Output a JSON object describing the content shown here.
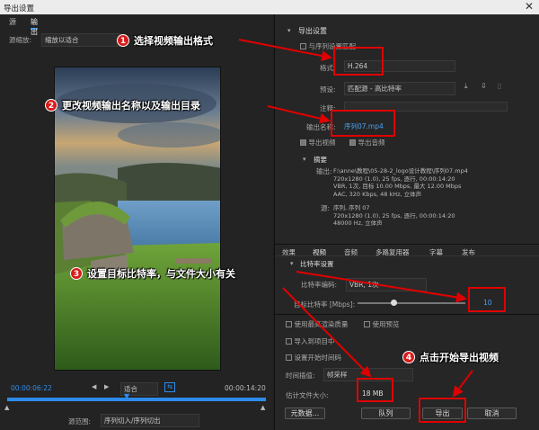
{
  "window": {
    "title": "导出设置",
    "close": "✕"
  },
  "left": {
    "tabs": [
      "源",
      "输出"
    ],
    "scale_label": "源缩放:",
    "scale_value": "缩放以适合",
    "time_current": "00:00:06:22",
    "time_end": "00:00:14:20",
    "fit_value": "适合",
    "source_range_label": "源范围:",
    "source_range_value": "序列切入/序列切出"
  },
  "right": {
    "section_title": "导出设置",
    "match_seq": "与序列设置匹配",
    "format_label": "格式:",
    "format_value": "H.264",
    "preset_label": "预设:",
    "preset_value": "匹配源 - 高比特率",
    "comments_label": "注释:",
    "output_name_label": "输出名称:",
    "output_name_value": "序列07.mp4",
    "export_video": "导出视频",
    "export_audio": "导出音频",
    "summary_title": "摘要",
    "output_label": "输出:",
    "output_lines": [
      "F:\\anne\\教程\\05-28-2_logo设计教程\\序列07.mp4",
      "720x1280 (1.0), 25 fps, 逐行, 00:00:14:20",
      "VBR, 1次, 目标 10.00 Mbps, 最大 12.00 Mbps",
      "AAC, 320 Kbps, 48 kHz, 立体声"
    ],
    "source_label": "源:",
    "source_lines": [
      "序列, 序列 07",
      "720x1280 (1.0), 25 fps, 逐行, 00:00:14:20",
      "48000 Hz, 立体声"
    ],
    "tabs": [
      "效果",
      "视频",
      "音频",
      "多路复用器",
      "字幕",
      "发布"
    ],
    "bitrate_section": "比特率设置",
    "bitrate_encoding_label": "比特率编码:",
    "bitrate_encoding_value": "VBR, 1次",
    "target_bitrate_label": "目标比特率 [Mbps]:",
    "target_bitrate_value": "10",
    "target_bitrate_level": 0.33,
    "max_render": "使用最高渲染质量",
    "use_preview": "使用预览",
    "import_project": "导入到项目中",
    "set_start_tc": "设置开始时间码",
    "time_interp_label": "时间插值:",
    "time_interp_value": "帧采样",
    "est_size_label": "估计文件大小:",
    "est_size_value": "18 MB",
    "buttons": {
      "metadata": "元数据...",
      "queue": "队列",
      "export": "导出",
      "cancel": "取消"
    }
  },
  "annotations": [
    {
      "num": "1",
      "text": "选择视频输出格式"
    },
    {
      "num": "2",
      "text": "更改视频输出名称以及输出目录"
    },
    {
      "num": "3",
      "text": "设置目标比特率，与文件大小有关"
    },
    {
      "num": "4",
      "text": "点击开始导出视频"
    }
  ],
  "colors": {
    "accent": "#2d8ceb",
    "annotation_red": "#e00000"
  }
}
